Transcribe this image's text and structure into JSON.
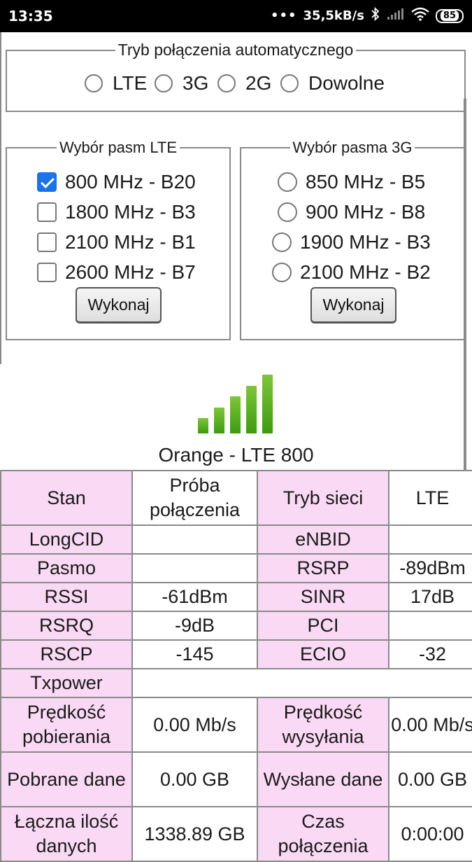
{
  "status_bar": {
    "time": "13:35",
    "speed": "35,5kB/s",
    "battery": "85"
  },
  "auto_mode": {
    "legend": "Tryb połączenia automatycznego",
    "options": [
      "LTE",
      "3G",
      "2G",
      "Dowolne"
    ]
  },
  "lte_bands": {
    "legend": "Wybór pasm LTE",
    "items": [
      {
        "label": "800 MHz - B20",
        "checked": true
      },
      {
        "label": "1800 MHz - B3",
        "checked": false
      },
      {
        "label": "2100 MHz - B1",
        "checked": false
      },
      {
        "label": "2600 MHz - B7",
        "checked": false
      }
    ],
    "button": "Wykonaj"
  },
  "band_3g": {
    "legend": "Wybór pasma 3G",
    "items": [
      {
        "label": "850 MHz - B5"
      },
      {
        "label": "900 MHz - B8"
      },
      {
        "label": "1900 MHz - B3"
      },
      {
        "label": "2100 MHz - B2"
      }
    ],
    "button": "Wykonaj"
  },
  "signal": {
    "level": 5,
    "max": 5,
    "color": "#5cb122"
  },
  "operator": "Orange - LTE 800",
  "table": {
    "rows": [
      [
        "Stan",
        "Próba połączenia",
        "Tryb sieci",
        "LTE"
      ],
      [
        "LongCID",
        "",
        "eNBID",
        ""
      ],
      [
        "Pasmo",
        "",
        "RSRP",
        "-89dBm"
      ],
      [
        "RSSI",
        "-61dBm",
        "SINR",
        "17dB"
      ],
      [
        "RSRQ",
        "-9dB",
        "PCI",
        ""
      ],
      [
        "RSCP",
        "-145",
        "ECIO",
        "-32"
      ],
      [
        "Txpower",
        ""
      ],
      [
        "Prędkość pobierania",
        "0.00 Mb/s",
        "Prędkość wysyłania",
        "0.00 Mb/s"
      ],
      [
        "Pobrane dane",
        "0.00 GB",
        "Wysłane dane",
        "0.00 GB"
      ],
      [
        "Łączna ilość danych",
        "1338.89 GB",
        "Czas połączenia",
        "0:00:00"
      ]
    ]
  },
  "colors": {
    "key_cell_bg": "#fad9f5",
    "checkbox_accent": "#1a73e8",
    "statusbar_bg": "#000000"
  }
}
